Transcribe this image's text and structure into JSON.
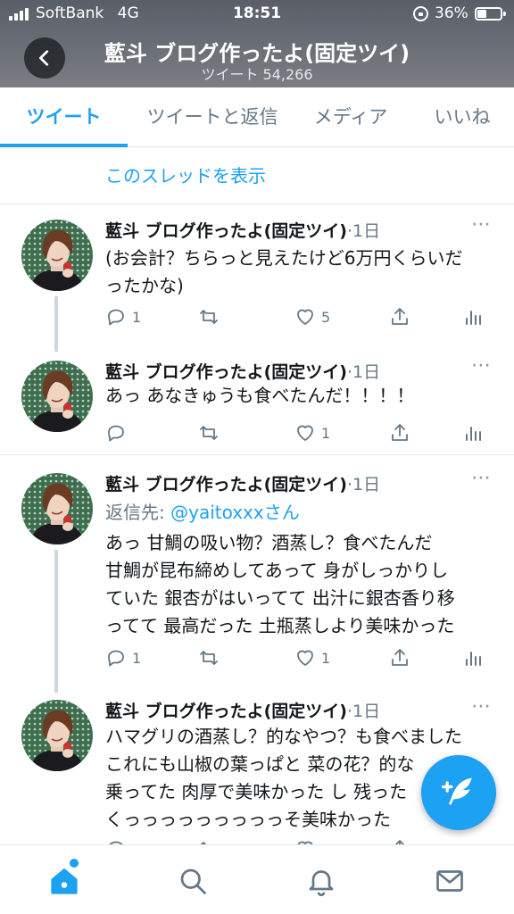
{
  "status_bar": {
    "carrier": "SoftBank",
    "network": "4G",
    "time": "18:51",
    "battery": "36%"
  },
  "header": {
    "title": "藍斗 ブログ作ったよ(固定ツイ)",
    "subtitle": "ツイート 54,266"
  },
  "tabs": [
    {
      "label": "ツイート",
      "active": true
    },
    {
      "label": "ツイートと返信",
      "active": false
    },
    {
      "label": "メディア",
      "active": false
    },
    {
      "label": "いいね",
      "active": false
    }
  ],
  "show_thread": "このスレッドを表示",
  "tweets": [
    {
      "name": "藍斗 ブログ作ったよ(固定ツイ)",
      "meta": "·1日",
      "reply_label": "",
      "reply_to": "",
      "text": "(お会計？ちらっと見えたけど6万円くらいだ\nったかな)",
      "replies": "1",
      "retweets": "",
      "likes": "5"
    },
    {
      "name": "藍斗 ブログ作ったよ(固定ツイ)",
      "meta": "·1日",
      "reply_label": "",
      "reply_to": "",
      "text": "あっ あなきゅうも食べたんだ！！！！",
      "replies": "",
      "retweets": "",
      "likes": "1"
    },
    {
      "name": "藍斗 ブログ作ったよ(固定ツイ)",
      "meta": "·1日",
      "reply_label": "返信先: ",
      "reply_to": "@yaitoxxxさん",
      "text": "あっ 甘鯛の吸い物？酒蒸し？食べたんだ\n甘鯛が昆布締めしてあって 身がしっかりし\nていた 銀杏がはいってて 出汁に銀杏香り移\nってて 最高だった 土瓶蒸しより美味かった",
      "replies": "1",
      "retweets": "",
      "likes": "1"
    },
    {
      "name": "藍斗 ブログ作ったよ(固定ツイ)",
      "meta": "·1日",
      "reply_label": "",
      "reply_to": "",
      "text": "ハマグリの酒蒸し？的なやつ？も食べました\nこれにも山椒の葉っぱと 菜の花？的な\n乗ってた 肉厚で美味かった し 残った\nくっっっっっっっっっそ美味かった",
      "replies": "",
      "retweets": "",
      "likes": ""
    }
  ],
  "icons": {
    "back": "chevron-left-icon",
    "reply": "reply-icon",
    "retweet": "retweet-icon",
    "like": "heart-icon",
    "share": "share-icon",
    "analytics": "analytics-icon",
    "compose": "compose-feather-icon",
    "home": "home-icon",
    "search": "search-icon",
    "notifications": "bell-icon",
    "messages": "mail-icon"
  },
  "colors": {
    "accent": "#1da1f2",
    "secondary_text": "#657786",
    "header_bg": "#6b6f76"
  }
}
